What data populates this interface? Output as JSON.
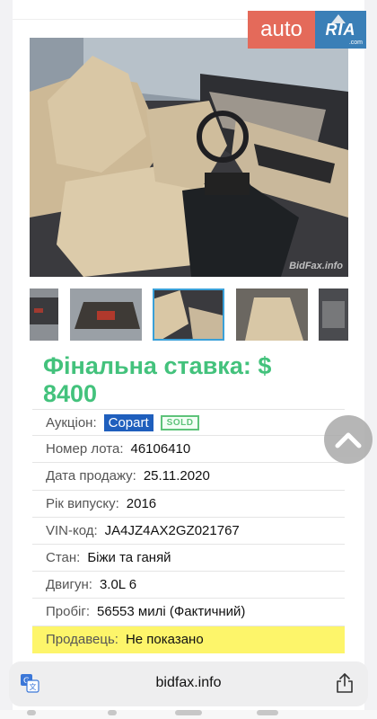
{
  "logo": {
    "auto": "auto",
    "ria": "RIA",
    "suffix": ".com"
  },
  "photo": {
    "watermark": "BidFax.info"
  },
  "thumbnails": [
    {
      "name": "thumbnail-1"
    },
    {
      "name": "thumbnail-2"
    },
    {
      "name": "thumbnail-3",
      "selected": true
    },
    {
      "name": "thumbnail-4"
    },
    {
      "name": "thumbnail-5"
    }
  ],
  "price": {
    "label": "Фінальна ставка: $ 8400"
  },
  "specs": {
    "auction": {
      "label": "Аукціон:",
      "value": "Copart",
      "badge": "SOLD"
    },
    "lot": {
      "label": "Номер лота:",
      "value": "46106410"
    },
    "sale_date": {
      "label": "Дата продажу:",
      "value": "25.11.2020"
    },
    "year": {
      "label": "Рік випуску:",
      "value": "2016"
    },
    "vin": {
      "label": "VIN-код:",
      "value": "JA4JZ4AX2GZ021767"
    },
    "condition": {
      "label": "Стан:",
      "value": "Біжи та ганяй"
    },
    "engine": {
      "label": "Двигун:",
      "value": "3.0L 6"
    },
    "mileage": {
      "label": "Пробіг:",
      "value": "56553 милі (Фактичний)"
    },
    "seller": {
      "label": "Продавець:",
      "value": "Не показано"
    }
  },
  "address_bar": {
    "url": "bidfax.info"
  },
  "colors": {
    "price_green": "#43c27c",
    "copart_blue": "#1f5fbd",
    "seller_highlight": "#fdf56a"
  },
  "icons": [
    "translate-icon",
    "share-icon",
    "chevron-up-icon"
  ]
}
